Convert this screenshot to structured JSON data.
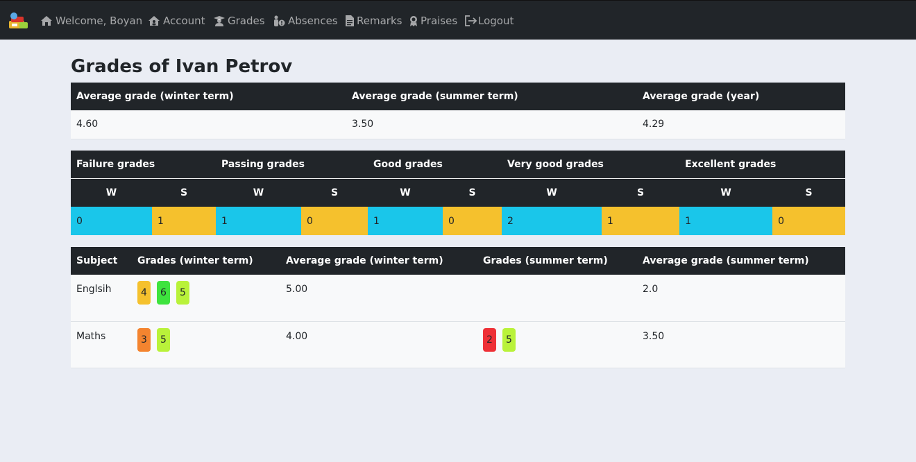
{
  "nav": {
    "welcome": "Welcome, Boyan",
    "account": "Account",
    "grades": "Grades",
    "absences": "Absences",
    "remarks": "Remarks",
    "praises": "Praises",
    "logout": "Logout"
  },
  "page": {
    "title": "Grades of Ivan Petrov"
  },
  "averages": {
    "headers": [
      "Average grade (winter term)",
      "Average grade (summer term)",
      "Average grade (year)"
    ],
    "values": [
      "4.60",
      "3.50",
      "4.29"
    ]
  },
  "counts": {
    "categories": [
      "Failure grades",
      "Passing grades",
      "Good grades",
      "Very good grades",
      "Excellent grades"
    ],
    "sub_headers": [
      "W",
      "S",
      "W",
      "S",
      "W",
      "S",
      "W",
      "S",
      "W",
      "S"
    ],
    "values": [
      "0",
      "1",
      "1",
      "0",
      "1",
      "0",
      "2",
      "1",
      "1",
      "0"
    ]
  },
  "subjects": {
    "headers": [
      "Subject",
      "Grades (winter term)",
      "Average grade (winter term)",
      "Grades (summer term)",
      "Average grade (summer term)"
    ],
    "rows": [
      {
        "name": "Englsih",
        "winter_grades": [
          "4",
          "6",
          "5"
        ],
        "winter_avg": "5.00",
        "summer_grades": [],
        "summer_avg": "2.0"
      },
      {
        "name": "Maths",
        "winter_grades": [
          "3",
          "5"
        ],
        "winter_avg": "4.00",
        "summer_grades": [
          "2",
          "5"
        ],
        "summer_avg": "3.50"
      }
    ]
  },
  "colors": {
    "navbar": "#212529",
    "winter_cell": "#1ac6ea",
    "summer_cell": "#f5c12d",
    "grade_2": "#ee3036",
    "grade_3": "#f4842f",
    "grade_4": "#f5c12d",
    "grade_5": "#b9f23a",
    "grade_6": "#3ee33e"
  }
}
